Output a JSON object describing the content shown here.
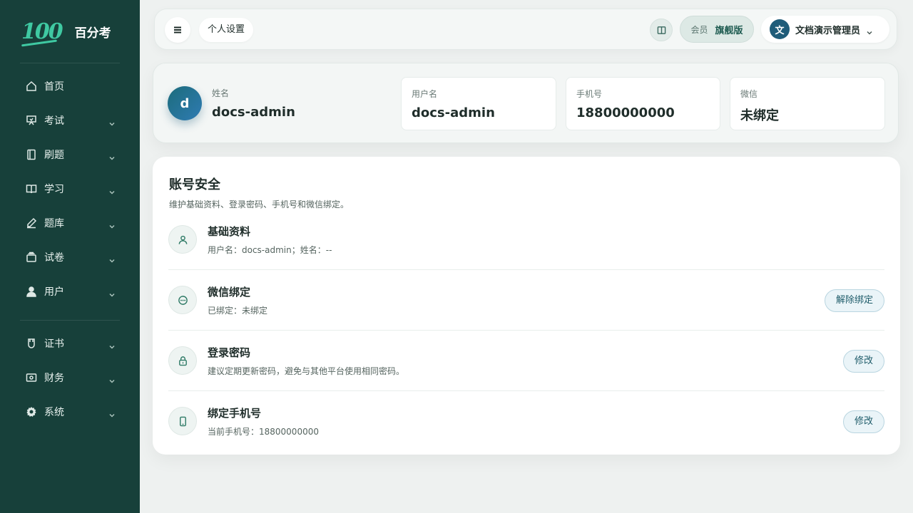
{
  "brand": {
    "logo": "100",
    "name": "百分考"
  },
  "sidebar": {
    "items": [
      {
        "label": "首页",
        "icon": "home-icon",
        "has_children": false
      },
      {
        "label": "考试",
        "icon": "presentation-icon",
        "has_children": true
      },
      {
        "label": "刷题",
        "icon": "notebook-icon",
        "has_children": true
      },
      {
        "label": "学习",
        "icon": "book-open-icon",
        "has_children": true
      },
      {
        "label": "题库",
        "icon": "pen-icon",
        "has_children": true
      },
      {
        "label": "试卷",
        "icon": "layers-icon",
        "has_children": true
      },
      {
        "label": "用户",
        "icon": "user-icon",
        "has_children": true
      }
    ],
    "items2": [
      {
        "label": "证书",
        "icon": "certificate-icon",
        "has_children": true
      },
      {
        "label": "财务",
        "icon": "wallet-icon",
        "has_children": true
      },
      {
        "label": "系统",
        "icon": "gear-icon",
        "has_children": true
      }
    ]
  },
  "topbar": {
    "breadcrumb": "个人设置",
    "member_label": "会员",
    "member_plan": "旗舰版",
    "user_initial": "文",
    "user_name": "文档演示管理员"
  },
  "profile": {
    "avatar_initial": "d",
    "name_label": "姓名",
    "name_value": "docs-admin",
    "username_label": "用户名",
    "username_value": "docs-admin",
    "phone_label": "手机号",
    "phone_value": "18800000000",
    "wechat_label": "微信",
    "wechat_value": "未绑定"
  },
  "security": {
    "title": "账号安全",
    "subtitle": "维护基础资料、登录密码、手机号和微信绑定。",
    "rows": [
      {
        "title": "基础资料",
        "desc": "用户名：docs-admin；姓名：--",
        "icon": "user-icon",
        "button": ""
      },
      {
        "title": "微信绑定",
        "desc": "已绑定：未绑定",
        "icon": "chat-icon",
        "button": "解除绑定"
      },
      {
        "title": "登录密码",
        "desc": "建议定期更新密码，避免与其他平台使用相同密码。",
        "icon": "lock-icon",
        "button": "修改"
      },
      {
        "title": "绑定手机号",
        "desc": "当前手机号：18800000000",
        "icon": "phone-icon",
        "button": "修改"
      }
    ]
  },
  "colors": {
    "sidebar_bg": "#17403a",
    "accent": "#3fc9a2",
    "avatar_blue": "#2f7bb3"
  }
}
